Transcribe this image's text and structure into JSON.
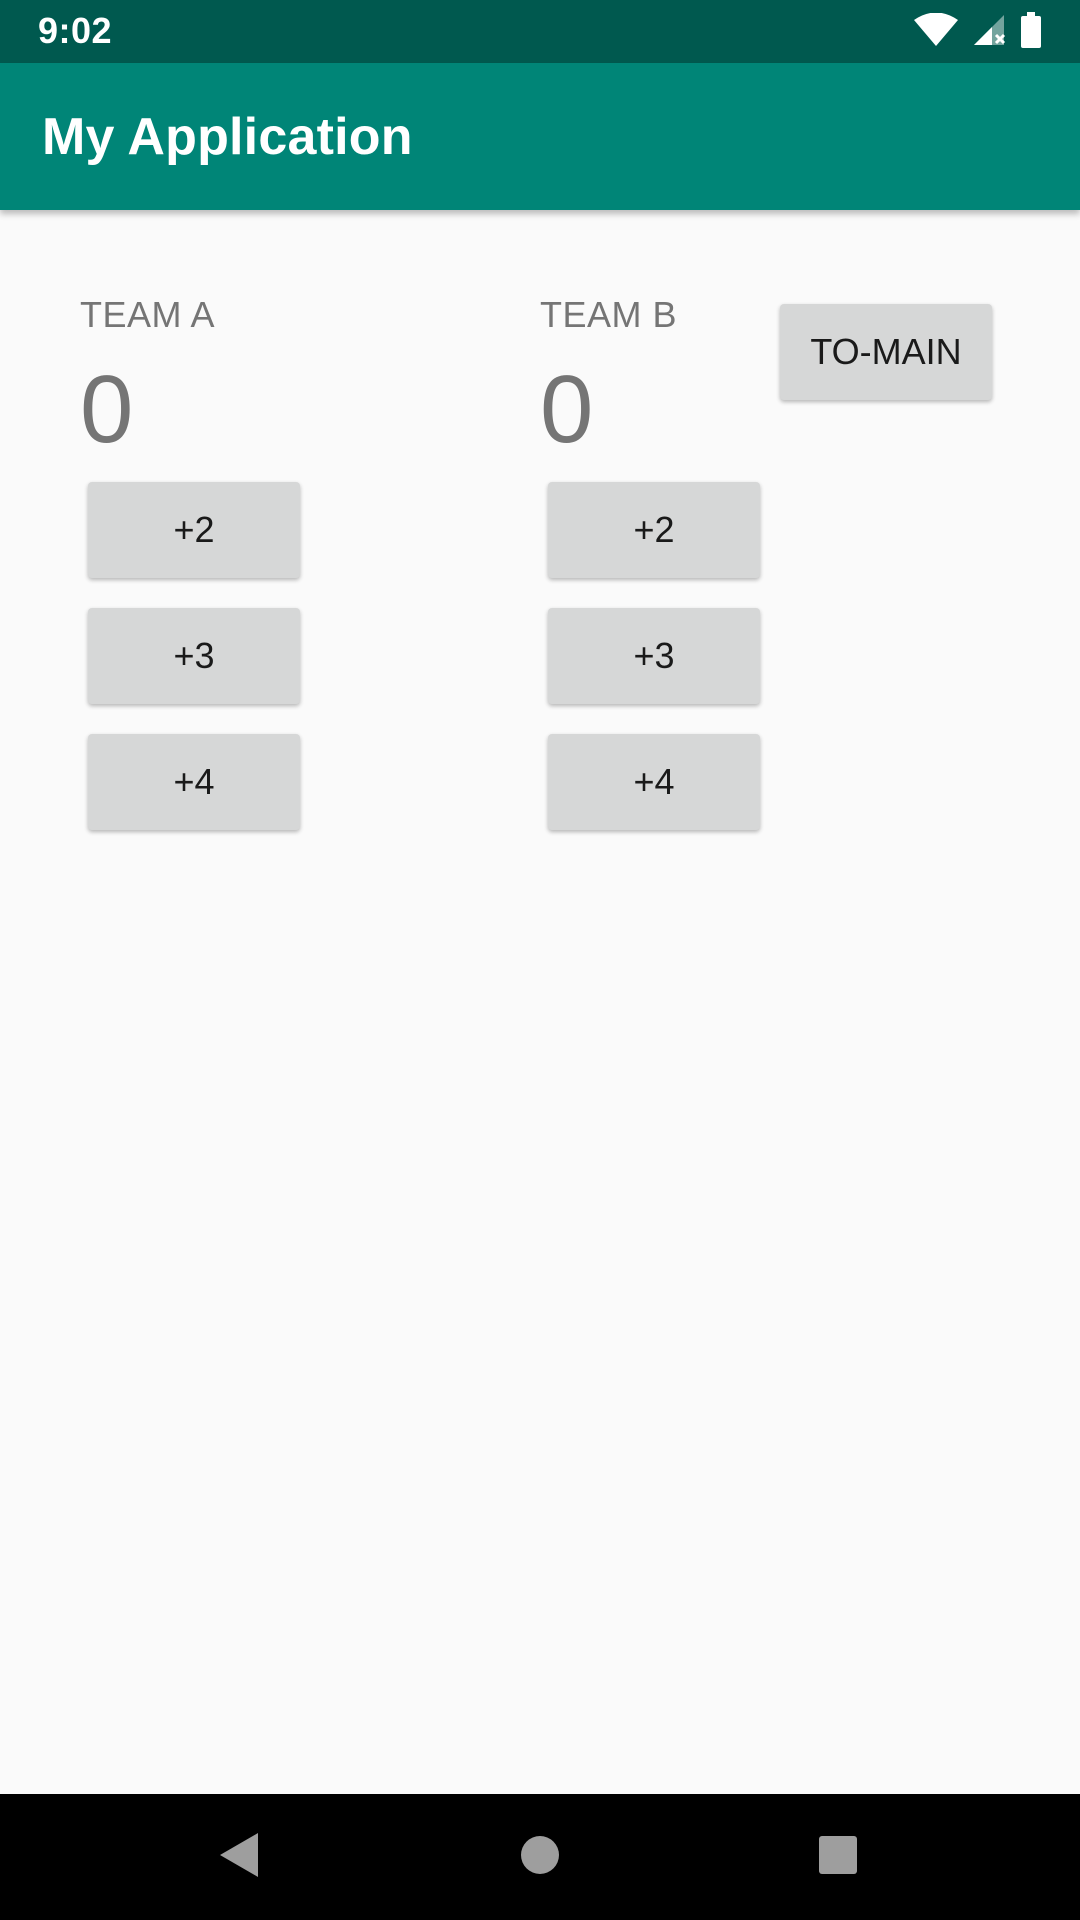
{
  "status_bar": {
    "time": "9:02",
    "icons": [
      "wifi-icon",
      "signal-icon",
      "battery-icon"
    ]
  },
  "app_bar": {
    "title": "My Application",
    "color": "#008577"
  },
  "team_a": {
    "label": "TEAM A",
    "score": "0",
    "buttons": [
      "+2",
      "+3",
      "+4"
    ]
  },
  "team_b": {
    "label": "TEAM B",
    "score": "0",
    "buttons": [
      "+2",
      "+3",
      "+4"
    ]
  },
  "to_main": {
    "label": "TO-MAIN"
  },
  "nav_bar": {
    "icons": [
      "back-icon",
      "home-icon",
      "recents-icon"
    ]
  }
}
